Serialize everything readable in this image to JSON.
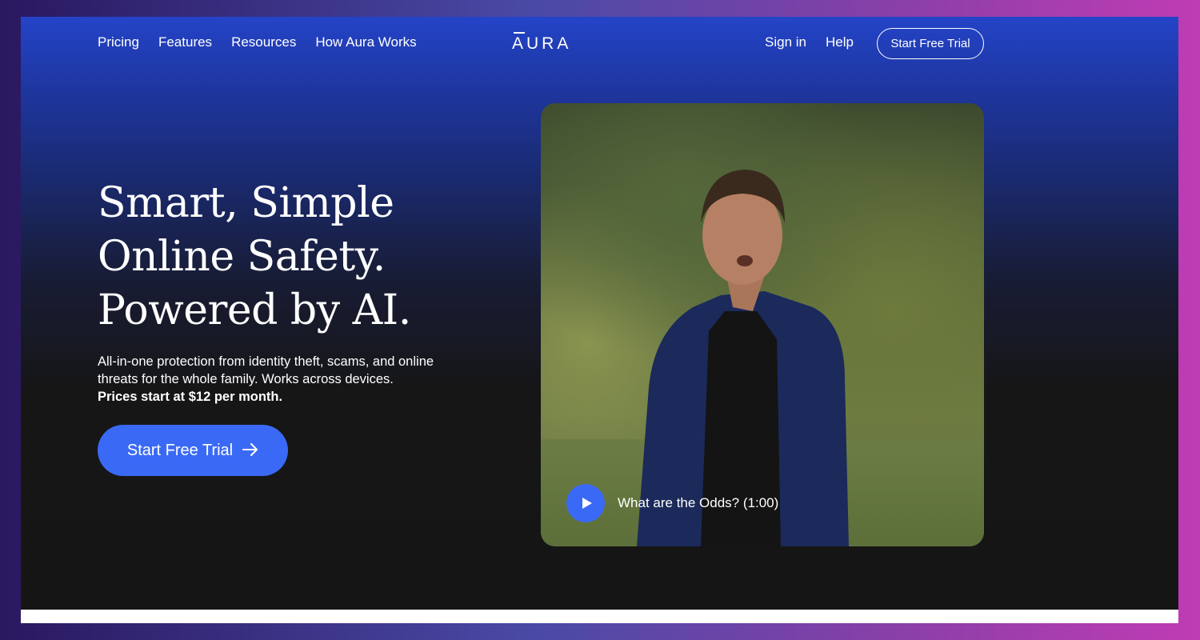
{
  "nav": {
    "links": [
      "Pricing",
      "Features",
      "Resources",
      "How Aura Works"
    ],
    "logo": "AURA",
    "sign_in": "Sign in",
    "help": "Help",
    "trial": "Start Free Trial"
  },
  "hero": {
    "headline": [
      "Smart, Simple",
      "Online Safety.",
      "Powered by AI."
    ],
    "body": "All-in-one protection from identity theft, scams, and online threats for the whole family. Works across devices.",
    "price": "Prices start at $12 per month.",
    "cta": "Start Free Trial",
    "cta_icon": "arrow-right-icon"
  },
  "video": {
    "caption": "What are the Odds? (1:00)",
    "play_icon": "play-icon"
  },
  "colors": {
    "accent": "#3a6af5",
    "background": "#151515",
    "header_blue": "#2444c8"
  }
}
